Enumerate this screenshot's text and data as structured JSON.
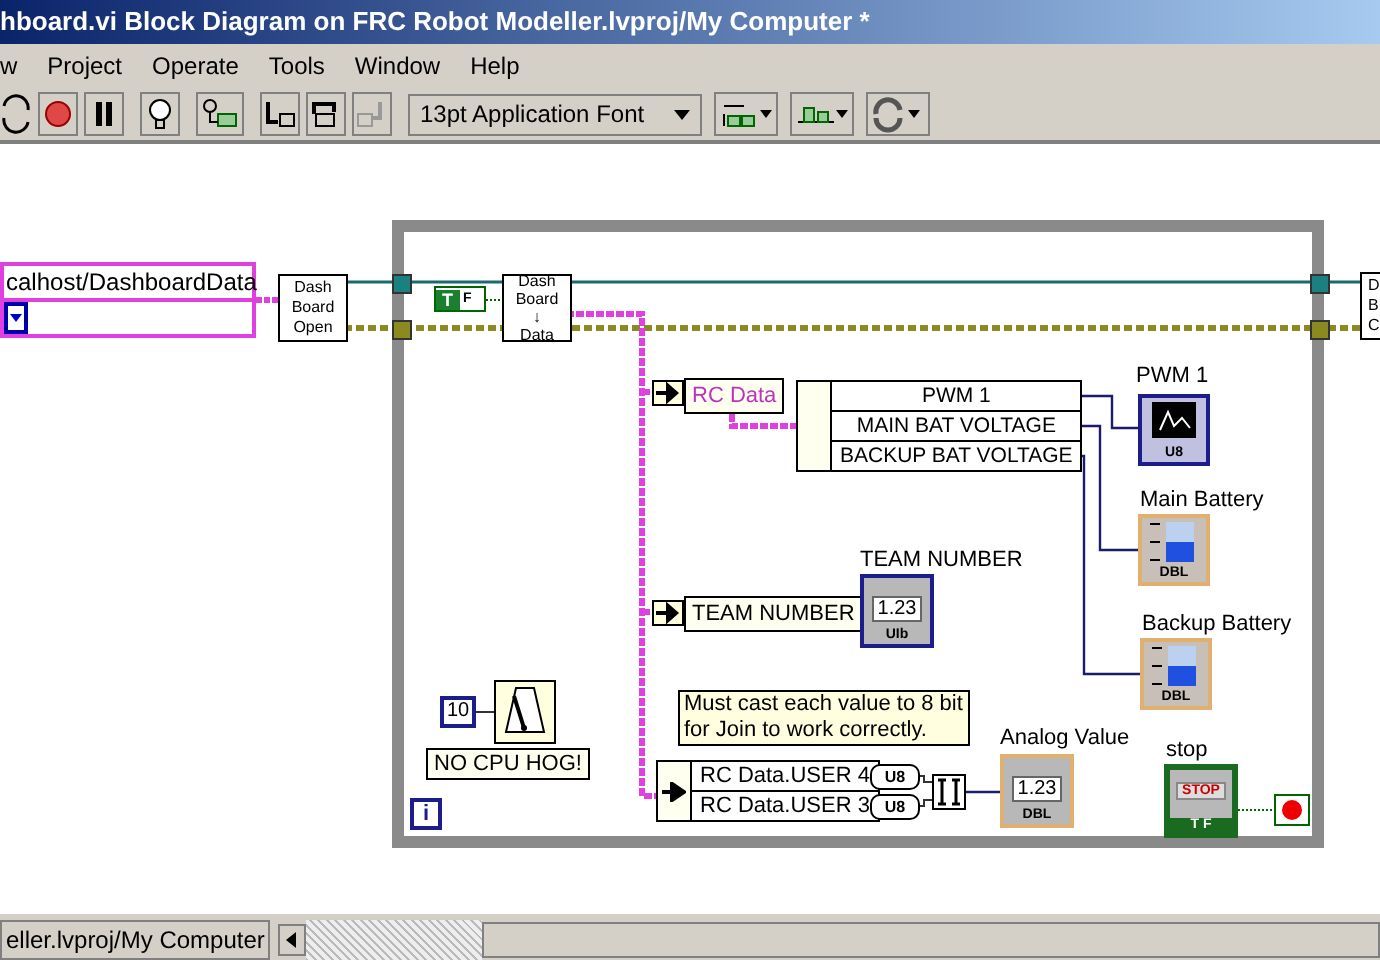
{
  "window": {
    "title": "hboard.vi Block Diagram on FRC Robot Modeller.lvproj/My Computer *"
  },
  "menu": [
    "w",
    "Project",
    "Operate",
    "Tools",
    "Window",
    "Help"
  ],
  "toolbar": {
    "font_selector": "13pt Application Font"
  },
  "diagram": {
    "string_constant": "calhost/DashboardData",
    "open_node": [
      "Dash",
      "Board",
      "Open"
    ],
    "boolean_constant": {
      "true_label": "T",
      "false_label": "F"
    },
    "read_node": [
      "Dash",
      "Board",
      "↓",
      "Data"
    ],
    "rc_data_label": "RC Data",
    "unbundle": [
      "PWM 1",
      "MAIN BAT VOLTAGE",
      "BACKUP BAT VOLTAGE"
    ],
    "indicators": [
      {
        "label": "PWM 1",
        "kind": "chart",
        "type": "U8"
      },
      {
        "label": "Main Battery",
        "kind": "tank",
        "type": "DBL"
      },
      {
        "label": "Backup Battery",
        "kind": "tank",
        "type": "DBL"
      }
    ],
    "team_number": {
      "field": "TEAM NUMBER",
      "label": "TEAM NUMBER",
      "display": "1.23",
      "type": "UIb"
    },
    "wait": {
      "constant": "10",
      "label": "NO CPU HOG!"
    },
    "iteration_terminal": "i",
    "comment": "Must cast each value to 8 bit for Join to work correctly.",
    "bundle": [
      "RC Data.USER 4",
      "RC Data.USER 3"
    ],
    "conversions": [
      "U8",
      "U8"
    ],
    "analog": {
      "label": "Analog Value",
      "display": "1.23",
      "type": "DBL"
    },
    "stop": {
      "label": "stop",
      "button": "STOP",
      "type": "T F"
    },
    "right_node": [
      "D",
      "B",
      "C"
    ]
  },
  "status": {
    "project": "eller.lvproj/My Computer"
  }
}
